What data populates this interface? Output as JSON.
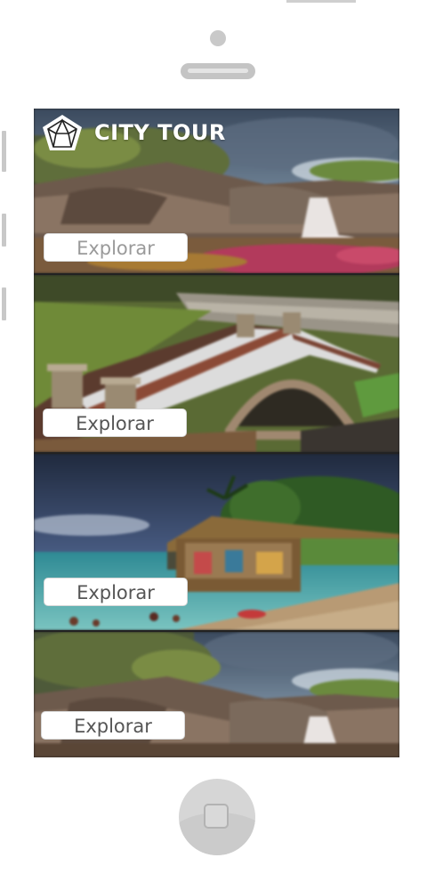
{
  "app": {
    "name": "CITY TOUR"
  },
  "panels": [
    {
      "button_label": "Explorar",
      "scene": "waterfall-river"
    },
    {
      "button_label": "Explorar",
      "scene": "stone-bridge"
    },
    {
      "button_label": "Explorar",
      "scene": "tropical-beach-pier"
    },
    {
      "button_label": "Explorar",
      "scene": "waterfall-river"
    }
  ],
  "colors": {
    "device_frame": "#c8c8c8",
    "button_bg": "#ffffff",
    "button_text": "#555555"
  },
  "icons": {
    "logo": "pentagon-logo-icon",
    "home": "home-button-icon",
    "camera": "front-camera-icon",
    "speaker": "speaker-grille-icon"
  }
}
